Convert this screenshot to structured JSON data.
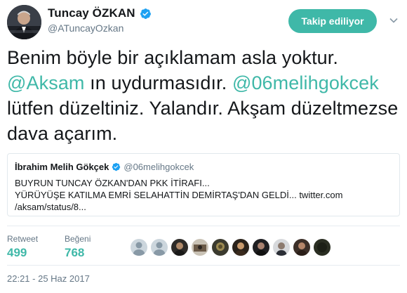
{
  "author": {
    "display_name": "Tuncay ÖZKAN",
    "handle": "@ATuncayOzkan",
    "verified": true
  },
  "follow_button": {
    "label": "Takip ediliyor",
    "color": "#3fb8a8"
  },
  "tweet": {
    "text_parts": [
      "Benim böyle bir açıklamam asla yoktur. ",
      "@Aksam",
      " ın uydurmasıdır. ",
      "@06melihgokcek",
      " lütfen düzeltiniz. Yalandır. Akşam düzeltmezse dava açarım."
    ],
    "mention_color": "#3fb8a8"
  },
  "quoted_tweet": {
    "display_name": "İbrahim Melih Gökçek",
    "handle": "@06melihgokcek",
    "verified": true,
    "lines": [
      "BUYRUN TUNCAY ÖZKAN'DAN PKK İTİRAFI...",
      "YÜRÜYÜŞE KATILMA EMRİ  SELAHATTİN DEMİRTAŞ'DAN GELDİ... twitter.com",
      "/aksam/status/8..."
    ]
  },
  "stats": {
    "retweets_label": "Retweet",
    "retweets_value": "499",
    "likes_label": "Beğeni",
    "likes_value": "768"
  },
  "likers": [
    "default-avatar",
    "default-avatar",
    "user-avatar",
    "user-avatar",
    "user-avatar",
    "user-avatar",
    "user-avatar",
    "user-avatar",
    "user-avatar",
    "user-avatar"
  ],
  "timestamp": "22:21 - 25 Haz 2017",
  "colors": {
    "accent": "#3fb8a8",
    "verified": "#1da1f2",
    "secondary_text": "#657786"
  }
}
